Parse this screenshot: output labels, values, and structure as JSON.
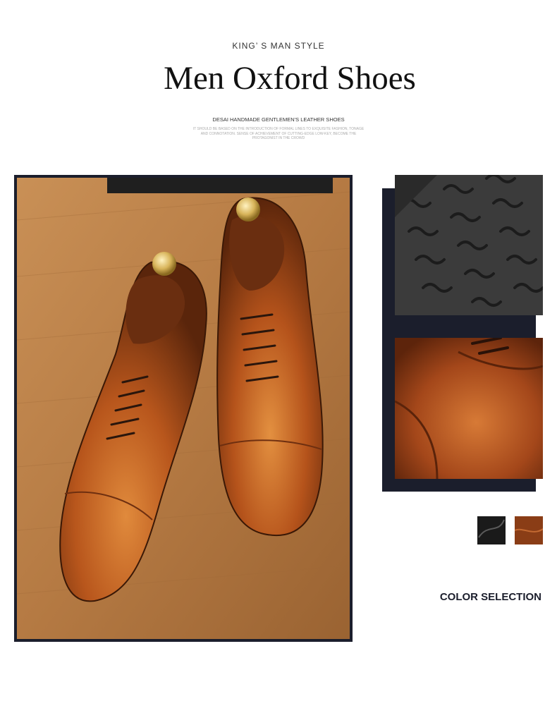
{
  "header": {
    "eyebrow": "KING’ S MAN STYLE",
    "title": "Men Oxford Shoes",
    "subtitle": "DESAI HANDMADE GENTLEMEN'S LEATHER SHOES",
    "fineprint": "IT SHOULD BE BASED ON THE INTRODUCTION OF FORMAL LINES TO EXQUISITE FASHION, TONAGE AND CONNOTATION. SENSE OF ACHIEVEMENT OF CUTTING-EDGE LOW-KEY, BECOME THE PROTAGONIST IN THE CROWD"
  },
  "images": {
    "main": "brown-oxford-shoes-pair-photo",
    "sole": "rubber-sole-wave-pattern-photo",
    "detail": "brown-leather-toe-cap-detail-photo"
  },
  "colors": {
    "navy": "#1b1e2c",
    "leather_brown": "#a8501e",
    "wood": "#b07a45"
  },
  "color_selection": {
    "label": "COLOR SELECTION",
    "options": [
      {
        "name": "black",
        "color": "#1a1a1a"
      },
      {
        "name": "brown",
        "color": "#8a3d16"
      }
    ]
  }
}
